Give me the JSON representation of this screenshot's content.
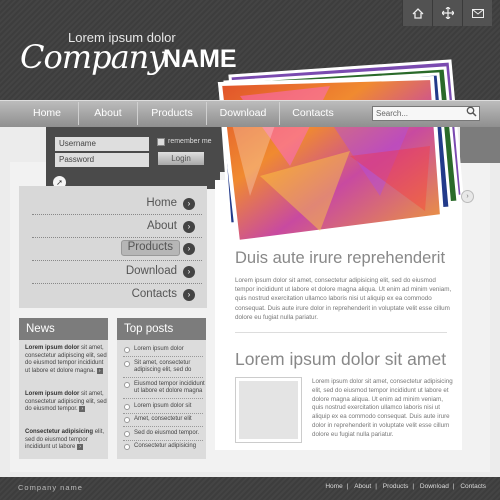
{
  "header": {
    "tagline": "Lorem ipsum dolor",
    "logo_script": "Company",
    "logo_name": "NAME",
    "icons": [
      "home-icon",
      "move-icon",
      "mail-icon"
    ]
  },
  "nav": {
    "items": [
      "Home",
      "About",
      "Products",
      "Download",
      "Contacts"
    ],
    "search_placeholder": "Search..."
  },
  "login": {
    "username_placeholder": "Username",
    "password_placeholder": "Password",
    "remember_label": "remember me",
    "login_label": "Login"
  },
  "menu": {
    "items": [
      "Home",
      "About",
      "Products",
      "Download",
      "Contacts"
    ],
    "active": "Products"
  },
  "news": {
    "title": "News",
    "items": [
      {
        "bold": "Lorem ipsum dolor",
        "text": "sit amet, consectetur adipiscing elit, sed do eiusmod tempor incididunt ut labore et dolore magna."
      },
      {
        "bold": "Lorem ipsum dolor",
        "text": "sit amet, consectetur adipiscing elit, sed do eiusmod tempor."
      },
      {
        "bold": "Consectetur adipisicing",
        "text": "elit, sed do eiusmod tempor incididunt ut labore"
      }
    ]
  },
  "top_posts": {
    "title": "Top posts",
    "items": [
      "Lorem ipsum dolor",
      "Sit amet, consectetur adipiscing elit, sed do",
      "Eiusmod tempor incididunt ut labore et dolore magna",
      "Lorem ipsum dolor sit",
      "Amet, consectetur elit",
      "Sed do eiusmod tempor.",
      "Consectetur adipisicing"
    ]
  },
  "main": {
    "heading1": "Duis aute irure reprehenderit",
    "paragraph1": "Lorem ipsum dolor sit amet, consectetur adipisicing elit, sed do eiusmod tempor incididunt ut labore et dolore magna aliqua. Ut enim ad minim veniam, quis nostrud exercitation ullamco laboris nisi ut aliquip ex ea commodo consequat. Duis aute irure dolor in reprehenderit in voluptate velit esse cillum dolore eu fugiat nulla pariatur.",
    "heading2": "Lorem ipsum dolor sit amet",
    "paragraph2": "Lorem ipsum dolor sit amet, consectetur adipisicing elit, sed do eiusmod tempor incididunt ut labore et dolore magna aliqua. Ut enim ad minim veniam, quis nostrud exercitation ullamco laboris nisi ut aliquip ex ea commodo consequat. Duis aute irure dolor in reprehenderit in voluptate velit esse cillum dolore eu fugiat nulla pariatur."
  },
  "footer": {
    "company": "Company name",
    "links": [
      "Home",
      "About",
      "Products",
      "Download",
      "Contacts"
    ],
    "separator": "|"
  }
}
